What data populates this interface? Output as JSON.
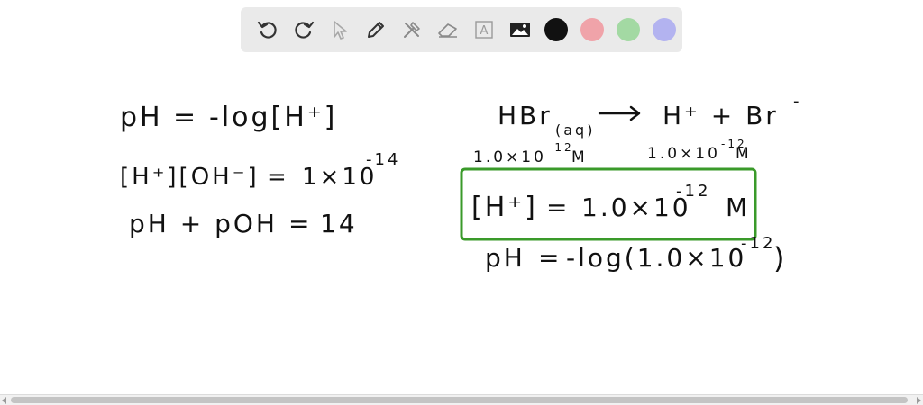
{
  "toolbar": {
    "tools": [
      {
        "name": "undo-icon"
      },
      {
        "name": "redo-icon"
      },
      {
        "name": "pointer-icon"
      },
      {
        "name": "pen-icon"
      },
      {
        "name": "tools-icon"
      },
      {
        "name": "eraser-icon"
      },
      {
        "name": "text-icon",
        "glyph": "A"
      },
      {
        "name": "image-icon"
      }
    ],
    "colors": {
      "black": "#111111",
      "red": "#f0a3a9",
      "green": "#a3d9a3",
      "blue": "#b3b3f0"
    }
  },
  "board": {
    "left": {
      "eq1": {
        "lhs": "pH",
        "op": "=",
        "rhs": "-log[H⁺]"
      },
      "eq2": {
        "lhs": "[H⁺][OH⁻]",
        "op": "=",
        "rhs": "1×10",
        "exp": "-14"
      },
      "eq3": {
        "lhs": "pH + pOH",
        "op": "=",
        "rhs": "14"
      }
    },
    "right": {
      "reaction": {
        "reactant": "HBr",
        "state": "(aq)",
        "products": "H⁺ + Br",
        "charge": "-"
      },
      "conc_left": {
        "mantissa": "1.0×10",
        "exp": "-12",
        "unit": "M"
      },
      "conc_right": {
        "mantissa": "1.0×10",
        "exp": "-12",
        "unit": "M"
      },
      "boxed": {
        "lhs": "[H⁺]",
        "op": "=",
        "mantissa": "1.0×10",
        "exp": "-12",
        "unit": "M"
      },
      "final": {
        "lhs": "pH",
        "op": "=",
        "rhs": "-log(1.0×10",
        "exp": "-12",
        "close": ")"
      }
    },
    "box_color": "#3a9a2a"
  }
}
